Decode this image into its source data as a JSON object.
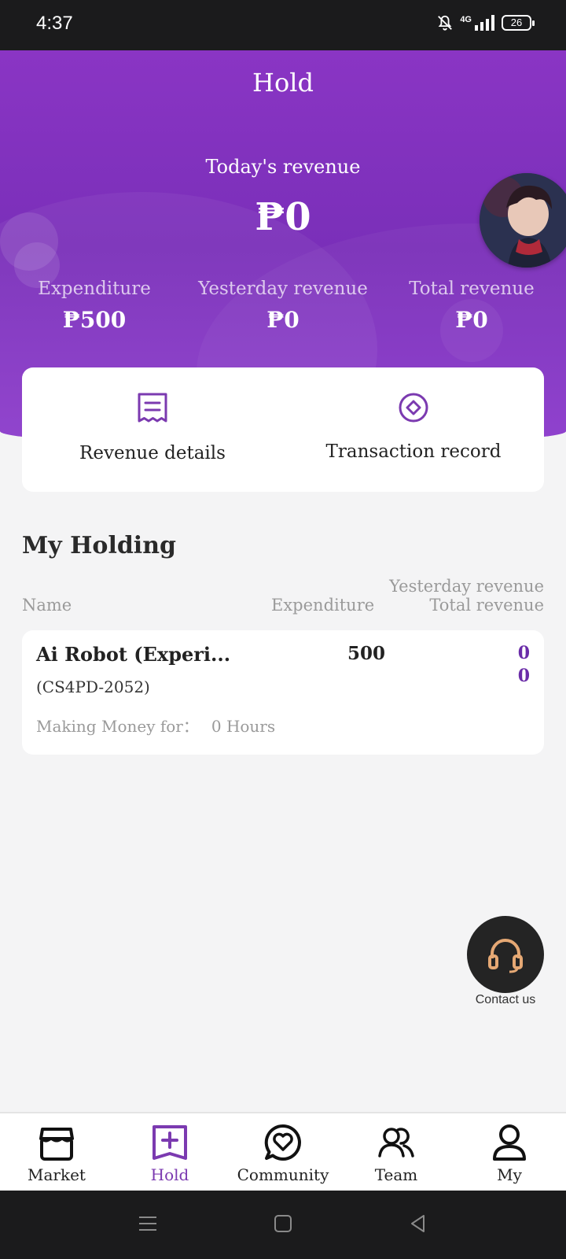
{
  "status_bar": {
    "time": "4:37",
    "network": "4G",
    "battery": "26"
  },
  "header": {
    "title": "Hold",
    "today_label": "Today's revenue",
    "today_value": "₱0",
    "stats": [
      {
        "label": "Expenditure",
        "value": "₱500"
      },
      {
        "label": "Yesterday revenue",
        "value": "₱0"
      },
      {
        "label": "Total revenue",
        "value": "₱0"
      }
    ]
  },
  "actions": [
    {
      "label": "Revenue details",
      "icon": "receipt-icon"
    },
    {
      "label": "Transaction record",
      "icon": "diamond-circle-icon"
    }
  ],
  "holdings": {
    "title": "My Holding",
    "columns": {
      "name": "Name",
      "expenditure": "Expenditure",
      "yesterday": "Yesterday revenue",
      "total": "Total revenue"
    },
    "items": [
      {
        "name": "Ai Robot (Experi...",
        "code": "(CS4PD-2052)",
        "making_label": "Making Money for：",
        "making_value": "0 Hours",
        "expenditure": "500",
        "yesterday": "0",
        "total": "0"
      }
    ]
  },
  "contact": {
    "label": "Contact us",
    "icon": "headset-icon"
  },
  "nav": [
    {
      "label": "Market",
      "icon": "store-icon"
    },
    {
      "label": "Hold",
      "icon": "hold-plus-icon",
      "active": true
    },
    {
      "label": "Community",
      "icon": "heart-chat-icon"
    },
    {
      "label": "Team",
      "icon": "team-icon"
    },
    {
      "label": "My",
      "icon": "user-icon"
    }
  ],
  "colors": {
    "brand": "#7b34b8",
    "accent": "#6a2ca8",
    "contact_bg": "#242424",
    "contact_icon": "#e5a874"
  }
}
